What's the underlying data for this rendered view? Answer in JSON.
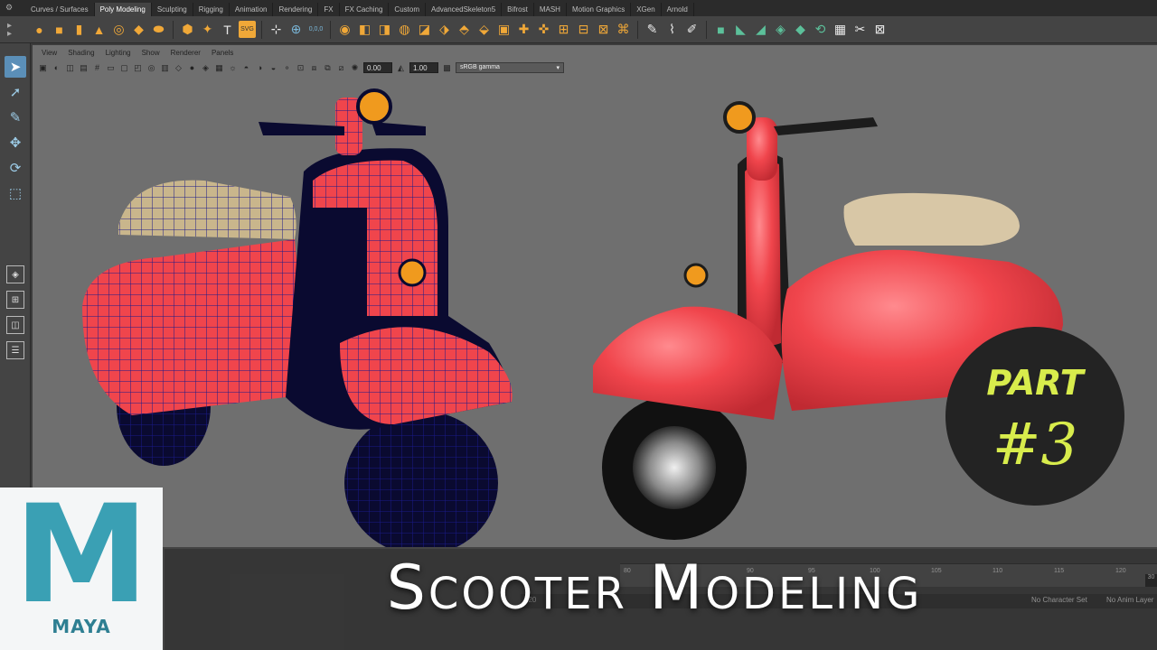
{
  "shelf": {
    "tabs": [
      {
        "label": "Curves / Surfaces",
        "active": false
      },
      {
        "label": "Poly Modeling",
        "active": true
      },
      {
        "label": "Sculpting",
        "active": false
      },
      {
        "label": "Rigging",
        "active": false
      },
      {
        "label": "Animation",
        "active": false
      },
      {
        "label": "Rendering",
        "active": false
      },
      {
        "label": "FX",
        "active": false
      },
      {
        "label": "FX Caching",
        "active": false
      },
      {
        "label": "Custom",
        "active": false
      },
      {
        "label": "AdvancedSkeleton5",
        "active": false
      },
      {
        "label": "Bifrost",
        "active": false
      },
      {
        "label": "MASH",
        "active": false
      },
      {
        "label": "Motion Graphics",
        "active": false
      },
      {
        "label": "XGen",
        "active": false
      },
      {
        "label": "Arnold",
        "active": false
      }
    ],
    "text_tool_label": "T",
    "svg_tool_label": "SVG",
    "numeric_readout": "0,0,0"
  },
  "panel": {
    "menus": [
      "View",
      "Shading",
      "Lighting",
      "Show",
      "Renderer",
      "Panels"
    ],
    "exposure_value": "0.00",
    "gamma_value": "1.00",
    "color_space": "sRGB gamma",
    "color_space_arrow": "▾"
  },
  "timeline": {
    "range_start": "120",
    "ticks": [
      "80",
      "85",
      "90",
      "95",
      "100",
      "105",
      "110",
      "115",
      "120"
    ],
    "frame_end": "30",
    "character_set_label": "No Character Set",
    "anim_layer_label": "No Anim Layer"
  },
  "overlay": {
    "title": "Scooter Modeling",
    "part_label": "PART",
    "part_number": "#3",
    "logo_word": "MAYA",
    "logo_letter": "M"
  },
  "colors": {
    "scooter_red": "#f0454c",
    "wire_blue": "#1a1a8a",
    "seat_tan": "#c9b68c",
    "headlight_orange": "#f09a1e",
    "badge_text": "#d8ec4c",
    "maya_teal": "#2e7f92"
  }
}
